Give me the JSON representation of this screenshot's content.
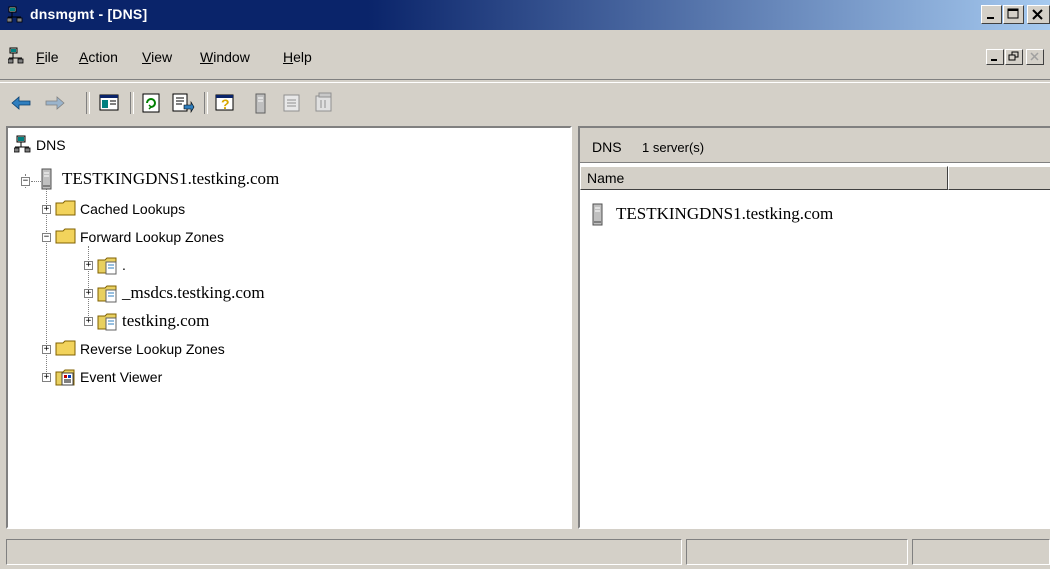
{
  "window": {
    "title": "dnsmgmt - [DNS]",
    "caption_buttons": [
      "minimize",
      "maximize",
      "close"
    ]
  },
  "menu": {
    "items": [
      {
        "label": "File",
        "mnemonic": "F",
        "rest": "ile"
      },
      {
        "label": "Action",
        "mnemonic": "A",
        "rest": "ction"
      },
      {
        "label": "View",
        "mnemonic": "V",
        "rest": "iew"
      },
      {
        "label": "Window",
        "mnemonic": "W",
        "rest": "indow"
      },
      {
        "label": "Help",
        "mnemonic": "H",
        "rest": "elp"
      }
    ],
    "mdi_buttons": [
      "minimize",
      "restore",
      "close"
    ]
  },
  "toolbar": {
    "buttons": [
      "back-arrow",
      "forward-arrow",
      "show-hide-console-tree",
      "refresh",
      "export-list",
      "help",
      "server",
      "properties",
      "delete"
    ]
  },
  "tree": {
    "root": "DNS",
    "server": "TESTKINGDNS1.testking.com",
    "cached_lookups": "Cached Lookups",
    "forward_lookup_zones": "Forward Lookup Zones",
    "zone_dot": ".",
    "zone_msdcs": "_msdcs.testking.com",
    "zone_testking": "testking.com",
    "reverse_lookup_zones": "Reverse Lookup Zones",
    "event_viewer": "Event Viewer"
  },
  "details": {
    "header_title": "DNS",
    "header_count": "1 server(s)",
    "columns": [
      "Name",
      ""
    ],
    "items": [
      {
        "name": "TESTKINGDNS1.testking.com"
      }
    ]
  },
  "status": {
    "cells": [
      "",
      "",
      ""
    ]
  },
  "colors": {
    "title_active_start": "#0a246a",
    "title_active_end": "#a6caf0",
    "face": "#d4d0c8",
    "folder": "#f2d35c"
  }
}
